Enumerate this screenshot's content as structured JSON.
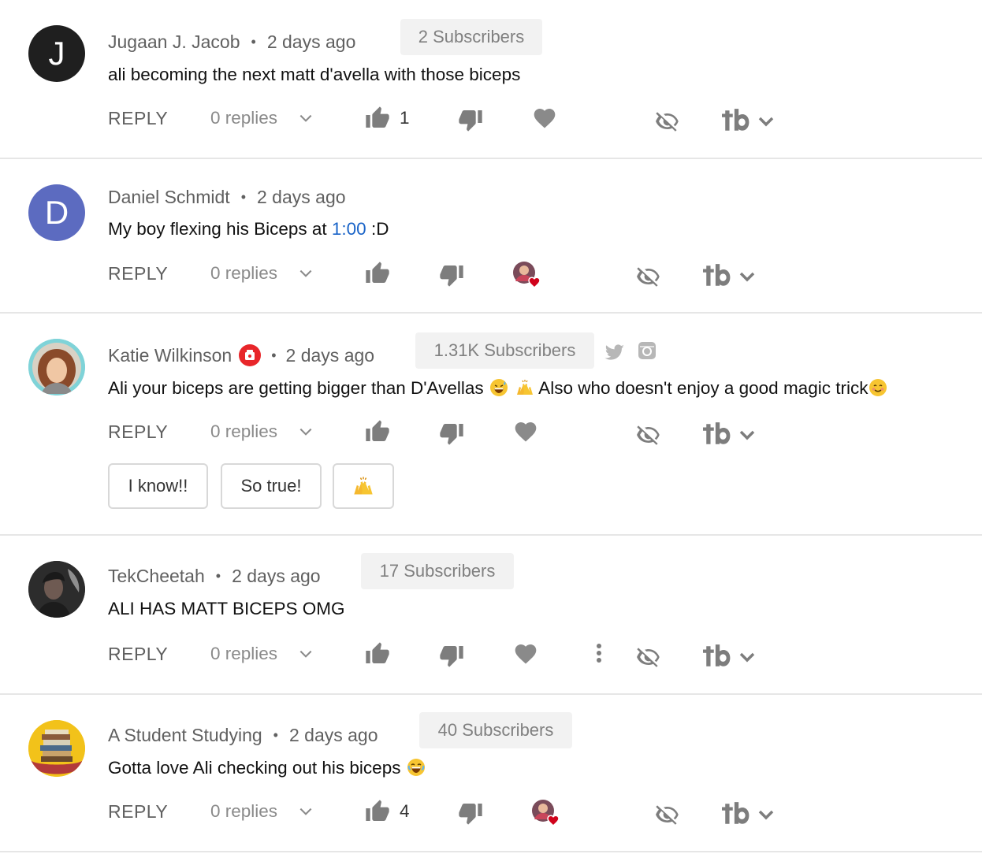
{
  "colors": {
    "link": "#1a64c8",
    "heart": "#d0021b",
    "muted": "#606060",
    "icon": "#7d7d7d"
  },
  "labels": {
    "reply": "REPLY",
    "dot": "•"
  },
  "comments": [
    {
      "author": "Jugaan J. Jacob",
      "avatar_letter": "J",
      "avatar_color": "#212121",
      "time": "2 days ago",
      "subscribers": "2 Subscribers",
      "text": "ali becoming the next matt d'avella with those biceps",
      "replies": "0 replies",
      "likes": "1"
    },
    {
      "author": "Daniel Schmidt",
      "avatar_letter": "D",
      "avatar_color": "#5c6bc0",
      "time": "2 days ago",
      "text_before": "My boy flexing his Biceps at ",
      "timestamp": "1:00",
      "text_after": " :D",
      "replies": "0 replies",
      "hearted": true
    },
    {
      "author": "Katie Wilkinson",
      "time": "2 days ago",
      "subscribers": "1.31K Subscribers",
      "text_a": "Ali your biceps are getting bigger than D'Avellas ",
      "text_b": " Also who doesn't enjoy a good magic trick",
      "replies": "0 replies",
      "quick_replies": [
        "I know!!",
        "So true!"
      ]
    },
    {
      "author": "TekCheetah",
      "time": "2 days ago",
      "subscribers": "17 Subscribers",
      "text": "ALI HAS MATT BICEPS OMG",
      "replies": "0 replies"
    },
    {
      "author": "A Student Studying",
      "time": "2 days ago",
      "subscribers": "40 Subscribers",
      "text": "Gotta love Ali checking out his biceps ",
      "replies": "0 replies",
      "likes": "4",
      "hearted": true
    }
  ]
}
